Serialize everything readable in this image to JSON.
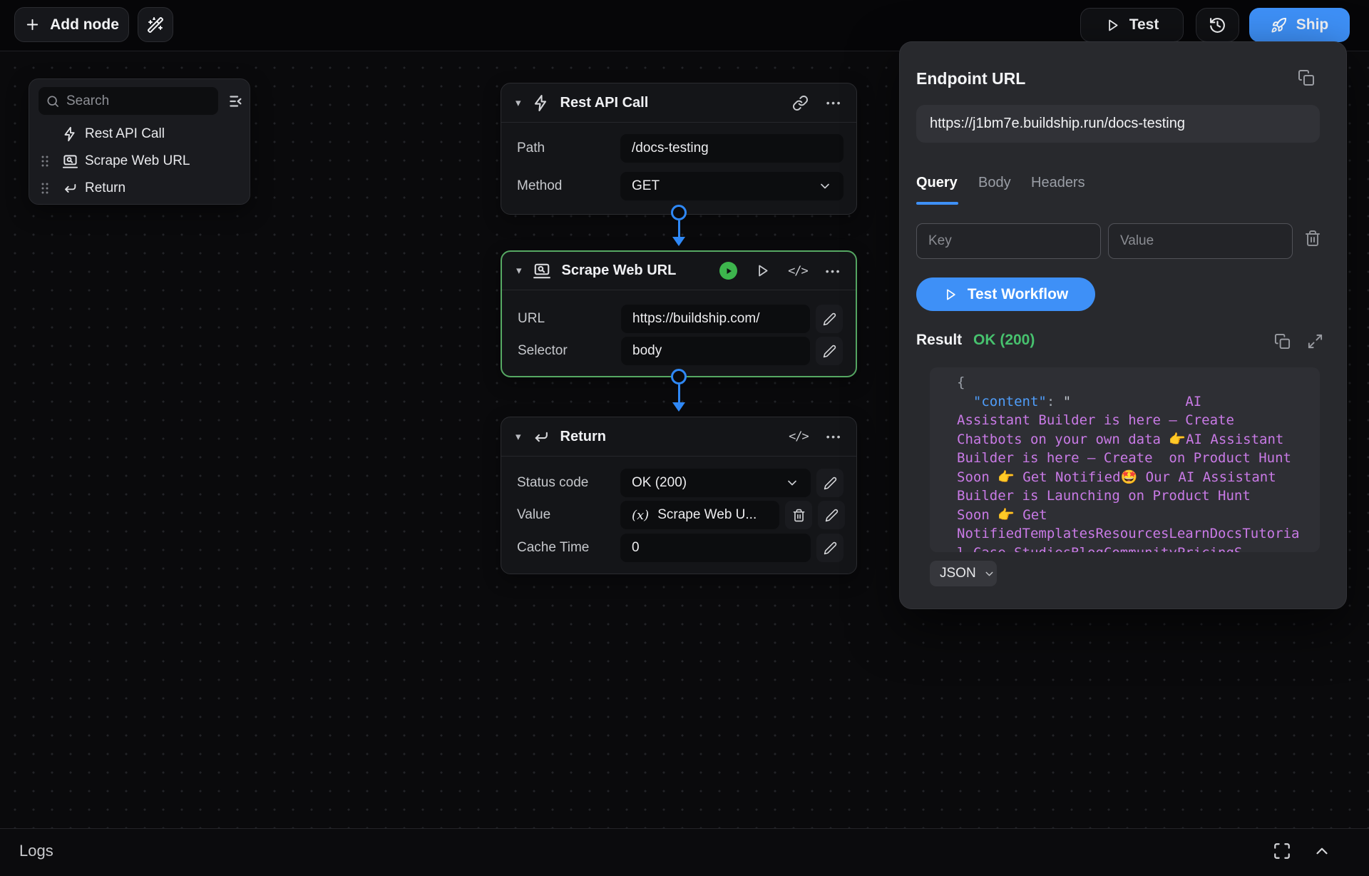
{
  "topbar": {
    "add_node_label": "Add node",
    "test_label": "Test",
    "ship_label": "Ship"
  },
  "palette": {
    "search_placeholder": "Search",
    "items": [
      {
        "label": "Rest API Call"
      },
      {
        "label": "Scrape Web URL"
      },
      {
        "label": "Return"
      }
    ]
  },
  "nodes": {
    "rest": {
      "title": "Rest API Call",
      "path_label": "Path",
      "path_value": "/docs-testing",
      "method_label": "Method",
      "method_value": "GET"
    },
    "scrape": {
      "title": "Scrape Web URL",
      "url_label": "URL",
      "url_value": "https://buildship.com/",
      "selector_label": "Selector",
      "selector_value": "body"
    },
    "return": {
      "title": "Return",
      "status_label": "Status code",
      "status_value": "OK (200)",
      "value_label": "Value",
      "value_prefix": "(x)",
      "value_chip": "Scrape Web U...",
      "cache_label": "Cache Time",
      "cache_value": "0"
    }
  },
  "inspector": {
    "endpoint_label": "Endpoint URL",
    "endpoint_url": "https://j1bm7e.buildship.run/docs-testing",
    "tabs": [
      {
        "label": "Query",
        "active": true
      },
      {
        "label": "Body",
        "active": false
      },
      {
        "label": "Headers",
        "active": false
      }
    ],
    "query": {
      "key_placeholder": "Key",
      "value_placeholder": "Value"
    },
    "test_workflow_label": "Test Workflow",
    "result": {
      "label": "Result",
      "status": "OK (200)",
      "format": "JSON",
      "code_lines": [
        [
          {
            "t": "{",
            "c": "gray"
          }
        ],
        [
          {
            "t": "  ",
            "c": "gray"
          },
          {
            "t": "\"content\"",
            "c": "blue"
          },
          {
            "t": ": ",
            "c": "gray"
          },
          {
            "t": "\"",
            "c": "quote"
          },
          {
            "t": "              AI",
            "c": "str"
          }
        ],
        [
          {
            "t": "Assistant Builder is here – Create",
            "c": "str"
          }
        ],
        [
          {
            "t": "Chatbots on your own data 👉AI Assistant",
            "c": "str"
          }
        ],
        [
          {
            "t": "Builder is here – Create  on Product Hunt",
            "c": "str"
          }
        ],
        [
          {
            "t": "Soon 👉 Get Notified🤩 Our AI Assistant",
            "c": "str"
          }
        ],
        [
          {
            "t": "Builder is Launching on Product Hunt",
            "c": "str"
          }
        ],
        [
          {
            "t": "Soon 👉 Get",
            "c": "str"
          }
        ],
        [
          {
            "t": "NotifiedTemplatesResourcesLearnDocsTutoria",
            "c": "str"
          }
        ],
        [
          {
            "t": "l Case StudiesBlogCommunityPricingS",
            "c": "str"
          }
        ]
      ]
    }
  },
  "logs": {
    "label": "Logs"
  },
  "icons": {
    "code": "</>",
    "ellipsis": "•••",
    "caret": "▾"
  },
  "colors": {
    "accent_blue": "#3e90f7",
    "connector_blue": "#2f88f6",
    "result_green": "#47c16e",
    "run_badge_green": "#3db54d",
    "selected_node_green": "#56a863",
    "code_key_blue": "#4f9df9",
    "code_string_purple": "#c97ae6"
  }
}
